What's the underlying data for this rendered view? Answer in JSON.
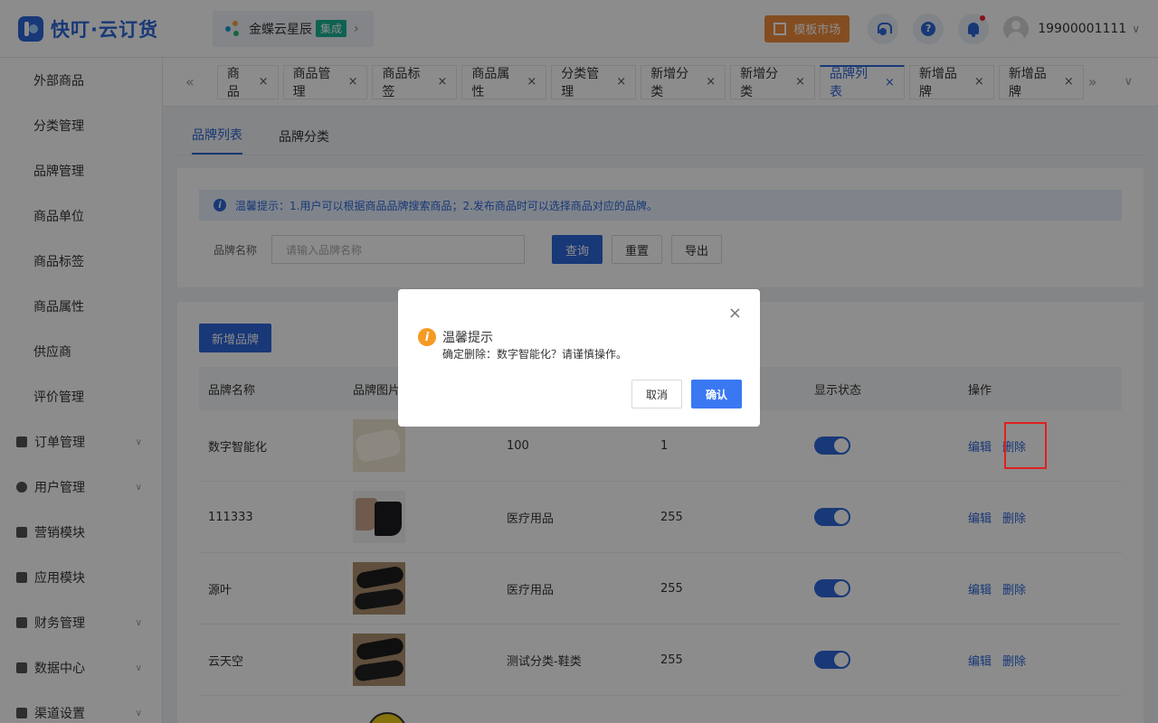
{
  "header": {
    "logo_text": "快叮·云订货",
    "org_name": "金蝶云星辰",
    "org_badge": "集成",
    "org_chevron": "›",
    "market_label": "模板市场",
    "help_glyph": "?",
    "user": "19900001111",
    "user_chevron": "∨"
  },
  "sidebar": {
    "items": [
      "外部商品",
      "分类管理",
      "品牌管理",
      "商品单位",
      "商品标签",
      "商品属性",
      "供应商",
      "评价管理"
    ],
    "groups": [
      "订单管理",
      "用户管理",
      "营销模块",
      "应用模块",
      "财务管理",
      "数据中心",
      "渠道设置"
    ]
  },
  "tabs": {
    "nav_left": "«",
    "nav_right": "»",
    "nav_menu": "∨",
    "close_glyph": "×",
    "items": [
      "商品",
      "商品管理",
      "商品标签",
      "商品属性",
      "分类管理",
      "新增分类",
      "新增分类",
      "品牌列表",
      "新增品牌",
      "新增品牌"
    ],
    "active_index": 7
  },
  "subtabs": [
    "品牌列表",
    "品牌分类"
  ],
  "notice": {
    "icon": "i",
    "text": "温馨提示：1.用户可以根据商品品牌搜索商品；2.发布商品时可以选择商品对应的品牌。"
  },
  "filter": {
    "label": "品牌名称",
    "placeholder": "请输入品牌名称",
    "query": "查询",
    "reset": "重置",
    "export": "导出"
  },
  "table": {
    "add_button": "新增品牌",
    "columns": [
      "品牌名称",
      "品牌图片",
      "",
      "",
      "显示状态",
      "操作"
    ],
    "rows": [
      {
        "name": "数字智能化",
        "category": "100",
        "sort": "1",
        "enabled": true
      },
      {
        "name": "111333",
        "category": "医疗用品",
        "sort": "255",
        "enabled": true
      },
      {
        "name": "源叶",
        "category": "医疗用品",
        "sort": "255",
        "enabled": true
      },
      {
        "name": "云天空",
        "category": "测试分类-鞋类",
        "sort": "255",
        "enabled": true
      }
    ],
    "edit_label": "编辑",
    "delete_label": "删除"
  },
  "dialog": {
    "close_glyph": "×",
    "icon": "i",
    "title": "温馨提示",
    "message": "确定删除：数字智能化？请谨慎操作。",
    "cancel": "取消",
    "confirm": "确认"
  },
  "colors": {
    "primary": "#2c66d9",
    "highlight": "#e02020",
    "warning": "#f59a23"
  }
}
